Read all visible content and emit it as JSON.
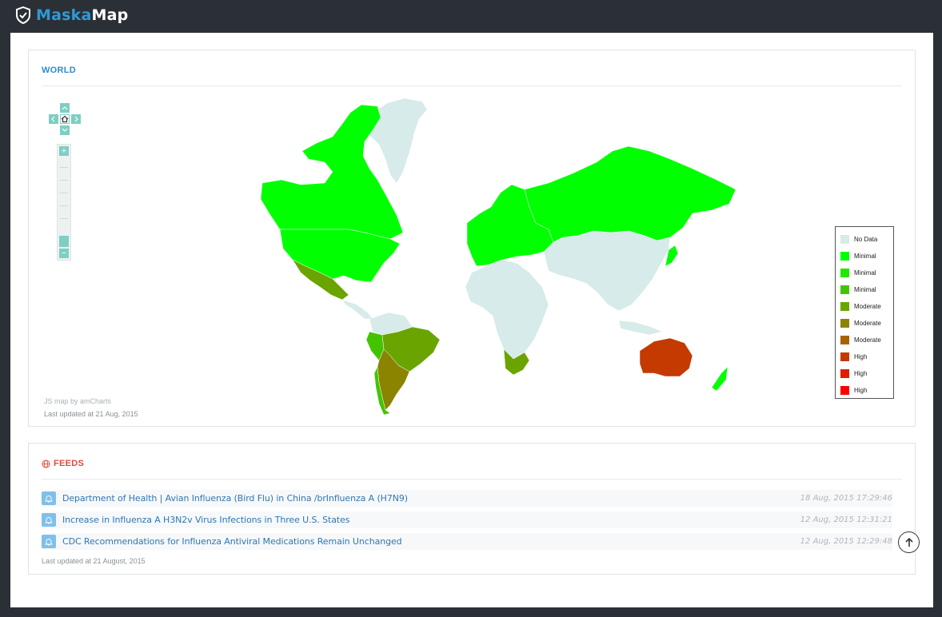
{
  "brand": {
    "part1": "Maska",
    "part2": "Map",
    "icon": "shield-check-icon"
  },
  "world": {
    "title": "WORLD",
    "credit": "JS map by amCharts",
    "updated": "Last updated at 21 Aug, 2015",
    "legend": [
      {
        "label": "No Data",
        "color": "#d6ebea"
      },
      {
        "label": "Minimal",
        "color": "#00ff00"
      },
      {
        "label": "Minimal",
        "color": "#22e800"
      },
      {
        "label": "Minimal",
        "color": "#44c400"
      },
      {
        "label": "Moderate",
        "color": "#6aa400"
      },
      {
        "label": "Moderate",
        "color": "#8a8400"
      },
      {
        "label": "Moderate",
        "color": "#a86200"
      },
      {
        "label": "High",
        "color": "#c43a00"
      },
      {
        "label": "High",
        "color": "#e01e00"
      },
      {
        "label": "High",
        "color": "#ff0000"
      }
    ],
    "nav_icons": [
      "chevron-up-icon",
      "chevron-left-icon",
      "home-icon",
      "chevron-right-icon",
      "chevron-down-icon"
    ],
    "zoom": {
      "plus": "+",
      "minus": "−"
    }
  },
  "feeds": {
    "title": "FEEDS",
    "icon": "globe-icon",
    "items": [
      {
        "title": "Department of Health | Avian Influenza (Bird Flu) in China /brInfluenza A (H7N9)",
        "date": "18 Aug, 2015 17:29:46"
      },
      {
        "title": "Increase in Influenza A H3N2v Virus Infections in Three U.S. States",
        "date": "12 Aug, 2015 12:31:21"
      },
      {
        "title": "CDC Recommendations for Influenza Antiviral Medications Remain Unchanged",
        "date": "12 Aug, 2015 12:29:48"
      }
    ],
    "updated": "Last updated at 21 August, 2015"
  },
  "scroll_top_icon": "arrow-up-circle-icon"
}
